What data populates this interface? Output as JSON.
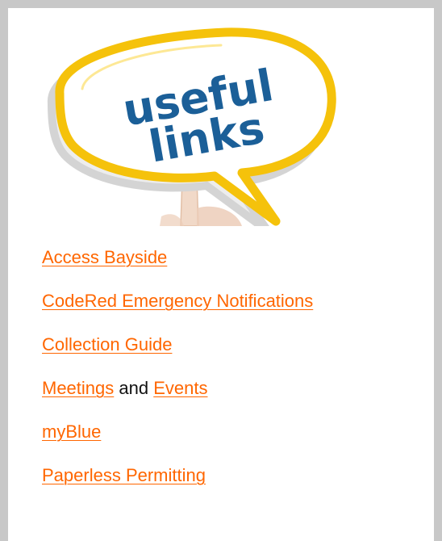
{
  "banner": {
    "word1": "useful",
    "word2": "links",
    "colors": {
      "bubble_outline": "#f5c20b",
      "bubble_shadow": "#d9d9d9",
      "text": "#1b5f98",
      "finger": "#f1d9c8"
    }
  },
  "links": {
    "access_bayside": "Access Bayside",
    "codered": "CodeRed Emergency Notifications",
    "collection_guide": "Collection Guide",
    "meetings": "Meetings",
    "and": " and ",
    "events": "Events",
    "myblue": "myBlue",
    "paperless_permitting": "Paperless Permitting"
  },
  "colors": {
    "link": "#ff6600",
    "border": "#c8c8c8",
    "text": "#111111"
  }
}
